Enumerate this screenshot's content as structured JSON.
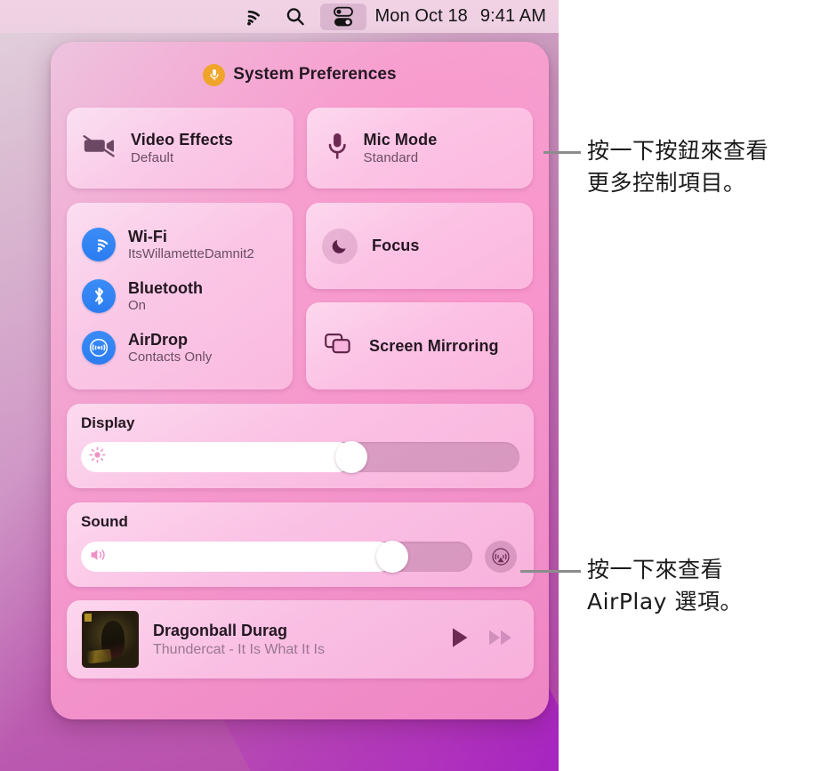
{
  "menubar": {
    "icons": [
      "wifi-icon",
      "search-icon",
      "control-center-icon"
    ],
    "date": "Mon Oct 18",
    "time": "9:41 AM"
  },
  "control_center": {
    "title": "System Preferences",
    "title_icon": "microphone-icon",
    "video_effects": {
      "label": "Video Effects",
      "value": "Default",
      "icon": "video-off-icon"
    },
    "mic_mode": {
      "label": "Mic Mode",
      "value": "Standard",
      "icon": "microphone-icon"
    },
    "connectivity": [
      {
        "label": "Wi-Fi",
        "value": "ItsWillametteDamnit2",
        "icon": "wifi-icon"
      },
      {
        "label": "Bluetooth",
        "value": "On",
        "icon": "bluetooth-icon"
      },
      {
        "label": "AirDrop",
        "value": "Contacts Only",
        "icon": "airdrop-icon"
      }
    ],
    "focus": {
      "label": "Focus",
      "icon": "moon-icon"
    },
    "screen_mirroring": {
      "label": "Screen Mirroring",
      "icon": "screen-mirroring-icon"
    },
    "display": {
      "label": "Display",
      "icon": "brightness-icon",
      "value_percent": 62
    },
    "sound": {
      "label": "Sound",
      "icon": "speaker-icon",
      "value_percent": 80,
      "airplay_icon": "airplay-audio-icon"
    },
    "now_playing": {
      "track": "Dragonball Durag",
      "subtitle": "Thundercat - It Is What It Is",
      "artwork": "album-artwork",
      "play_icon": "play-icon",
      "next_icon": "fast-forward-icon"
    }
  },
  "annotations": [
    {
      "text": "按一下按鈕來查看\n更多控制項目。"
    },
    {
      "text": "按一下來查看\nAirPlay 選項。"
    }
  ],
  "colors": {
    "accent_blue": "#2b7cf0",
    "title_icon_orange": "#f0a42a",
    "panel_pink": "#f398cd",
    "leader_gray": "#8c8c8c"
  }
}
